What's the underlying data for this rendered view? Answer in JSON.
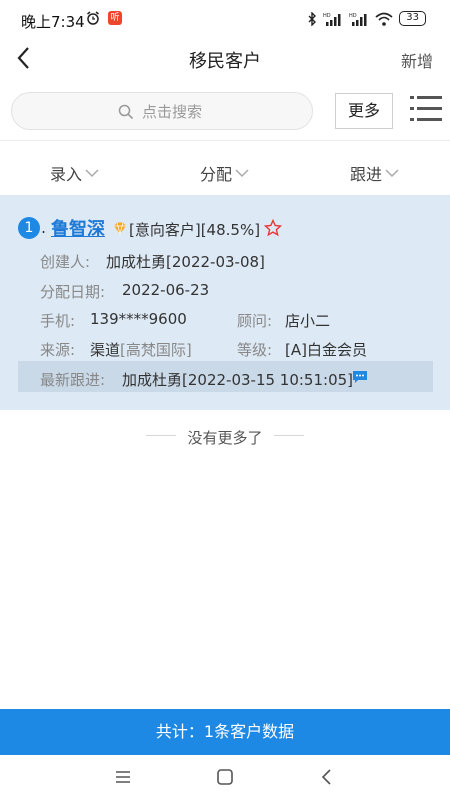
{
  "status_bar": {
    "time": "晚上7:34",
    "app_badge": "听",
    "battery": "33"
  },
  "nav": {
    "title": "移民客户",
    "action": "新增"
  },
  "search": {
    "placeholder": "点击搜索",
    "more_button": "更多"
  },
  "filters": [
    {
      "label": "录入"
    },
    {
      "label": "分配"
    },
    {
      "label": "跟进"
    }
  ],
  "customers": [
    {
      "index": "1",
      "index_suffix": ".",
      "name": "鲁智深",
      "status": "[意向客户][48.5%]",
      "creator_label": "创建人:",
      "creator_value": "加成杜勇[2022-03-08]",
      "assign_label": "分配日期:",
      "assign_value": "2022-06-23",
      "phone_label": "手机:",
      "phone_value": "139****9600",
      "advisor_label": "顾问:",
      "advisor_value": "店小二",
      "source_label": "来源:",
      "source_value": "渠道",
      "source_sub": "[高梵国际]",
      "level_label": "等级:",
      "level_value": "[A]白金会员",
      "follow_label": "最新跟进:",
      "follow_value": "加成杜勇[2022-03-15 10:51:05]"
    }
  ],
  "list_end": "没有更多了",
  "total": "共计：1条客户数据",
  "colors": {
    "accent": "#1e88e5",
    "card_bg": "#dde9f4",
    "follow_bg": "#c9d9e8",
    "star": "#e53935",
    "vip": "#f5a623",
    "app_badge": "#f0442c"
  }
}
